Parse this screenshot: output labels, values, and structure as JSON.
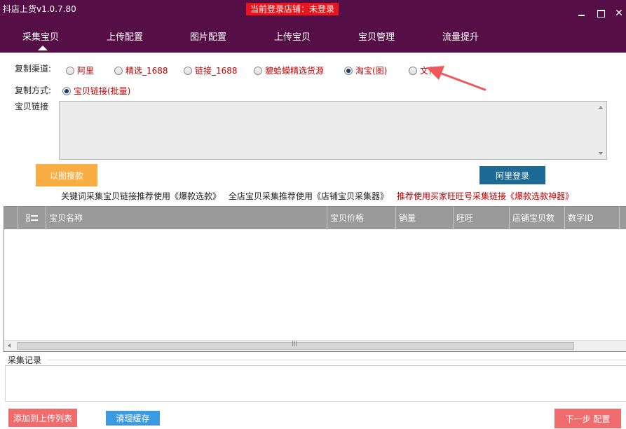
{
  "app": {
    "title": "抖店上货v1.0.7.80",
    "login_status": "当前登录店铺：未登录"
  },
  "nav": {
    "items": [
      {
        "label": "采集宝贝"
      },
      {
        "label": "上传配置"
      },
      {
        "label": "图片配置"
      },
      {
        "label": "上传宝贝"
      },
      {
        "label": "宝贝管理"
      },
      {
        "label": "流量提升"
      }
    ],
    "active": "采集宝贝"
  },
  "form": {
    "channel_label": "复制渠道:",
    "channels": [
      {
        "label": "阿里",
        "checked": false
      },
      {
        "label": "精选_1688",
        "checked": false
      },
      {
        "label": "链接_1688",
        "checked": false
      },
      {
        "label": "貔蛤蟆精选货源",
        "checked": false
      },
      {
        "label": "淘宝(图)",
        "checked": true
      },
      {
        "label": "文件",
        "checked": false
      }
    ],
    "method_label": "复制方式:",
    "method_option": "宝贝链接(批量)",
    "links_label": "宝贝链接",
    "links_value": ""
  },
  "buttons": {
    "image_search": "以图搜款",
    "ali_login": "阿里登录",
    "add_to_upload": "添加到上传列表",
    "clear_cache": "清理缓存",
    "next_step": "下一步 配置"
  },
  "hints": {
    "keyword": "关键词采集宝贝链接推荐使用《爆款选款》",
    "shop": "全店宝贝采集推荐使用《店铺宝贝采集器》",
    "recommend": "推荐使用买家旺旺号采集链接《爆款选款神器》"
  },
  "table": {
    "columns": [
      "宝贝名称",
      "宝贝价格",
      "销量",
      "旺旺",
      "店铺宝贝数",
      "数字ID"
    ],
    "rows": []
  },
  "log": {
    "label": "采集记录"
  },
  "colors": {
    "header_bg": "#560e47",
    "status_red": "#e8151c",
    "orange_button": "#f9ae43",
    "blue_button": "#1d6a96",
    "pink_button": "#f06b6b",
    "light_blue_button": "#3b9ae0",
    "hint_red": "#c00000"
  }
}
